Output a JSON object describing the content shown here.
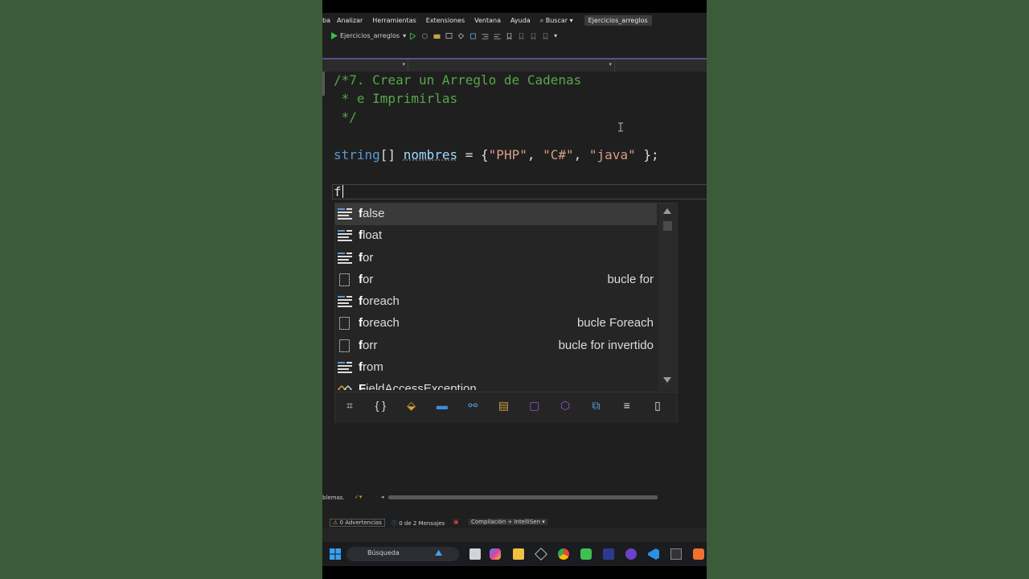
{
  "menu": {
    "items": [
      "ba",
      "Analizar",
      "Herramientas",
      "Extensiones",
      "Ventana",
      "Ayuda"
    ],
    "search_label": "⌕ Buscar ▾",
    "solution_title": "Ejercicios_arreglos"
  },
  "toolbar": {
    "run_target": "Ejercicios_arreglos"
  },
  "code": {
    "line1": "/*7. Crear un Arreglo de Cadenas",
    "line2": " * e Imprimirlas",
    "line3": " */",
    "line4_kw": "string",
    "line4_brackets": "[] ",
    "line4_id": "nombres",
    "line4_eq": " = {",
    "line4_s1": "\"PHP\"",
    "line4_c1": ", ",
    "line4_s2": "\"C#\"",
    "line4_c2": ", ",
    "line4_s3": "\"java\"",
    "line4_end": " };",
    "typed": "f"
  },
  "intellisense": {
    "items": [
      {
        "match": "f",
        "rest": "alse",
        "desc": "",
        "icon": "keyword-icon",
        "selected": true
      },
      {
        "match": "f",
        "rest": "loat",
        "desc": "",
        "icon": "keyword-icon"
      },
      {
        "match": "f",
        "rest": "or",
        "desc": "",
        "icon": "keyword-icon"
      },
      {
        "match": "f",
        "rest": "or",
        "desc": "bucle for",
        "icon": "snippet-icon"
      },
      {
        "match": "f",
        "rest": "oreach",
        "desc": "",
        "icon": "keyword-icon"
      },
      {
        "match": "f",
        "rest": "oreach",
        "desc": "bucle Foreach",
        "icon": "snippet-icon"
      },
      {
        "match": "f",
        "rest": "orr",
        "desc": "bucle for invertido",
        "icon": "snippet-icon"
      },
      {
        "match": "f",
        "rest": "rom",
        "desc": "",
        "icon": "keyword-icon"
      },
      {
        "match": "F",
        "rest": "ieldAccessException",
        "desc": "",
        "icon": "class-icon"
      }
    ],
    "filters": [
      "locals-filter-icon",
      "namespace-filter-icon",
      "class-filter-icon",
      "struct-filter-icon",
      "interface-filter-icon",
      "enum-filter-icon",
      "delegate-filter-icon",
      "module-filter-icon",
      "extension-filter-icon",
      "keyword-filter-icon",
      "snippet-filter-icon"
    ]
  },
  "panes": {
    "problems_label": "blemas.",
    "warnings": "0 Advertencias",
    "messages": "0 de 2 Mensajes",
    "build_filter": "Compilación + IntelliSen ▾"
  },
  "taskbar": {
    "search_label": "Búsqueda"
  },
  "colors": {
    "comment": "#57a64a",
    "keyword": "#569cd6",
    "identifier": "#9cdcfe",
    "string": "#d69d85",
    "accent_purple": "#5d4e8a",
    "background": "#1f1f1f",
    "desktop": "#3c5b38"
  }
}
